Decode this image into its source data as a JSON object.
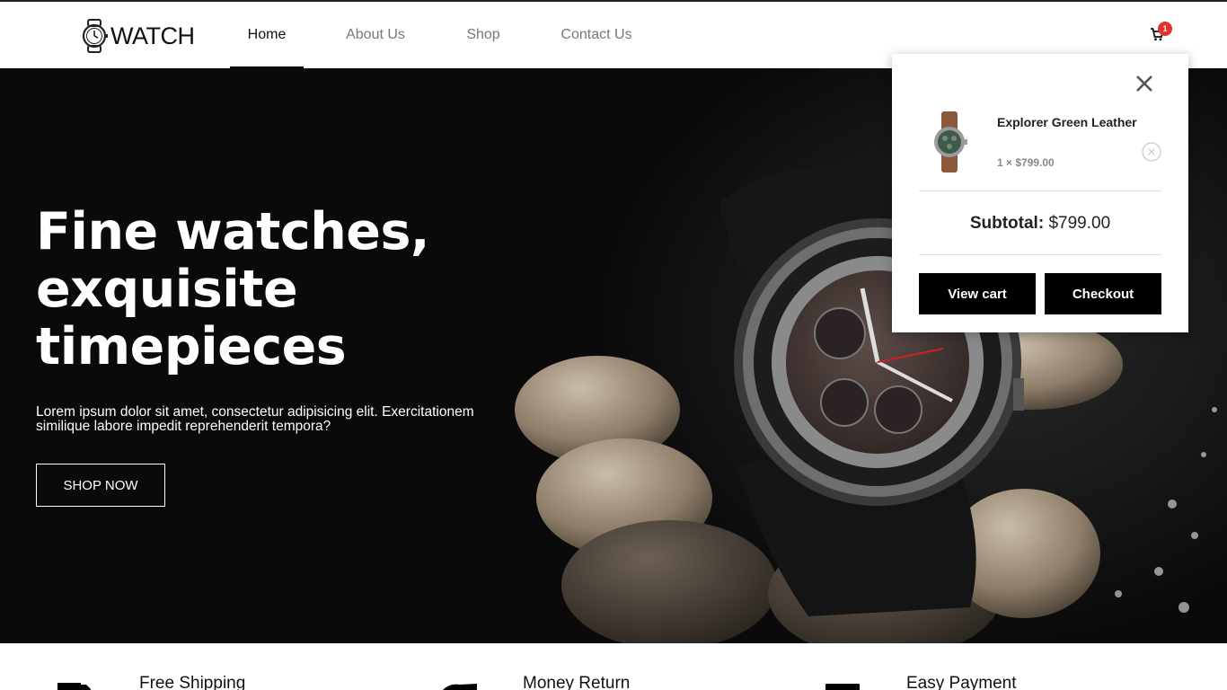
{
  "header": {
    "logo_text": "WATCH",
    "nav": [
      {
        "label": "Home",
        "active": true
      },
      {
        "label": "About Us",
        "active": false
      },
      {
        "label": "Shop",
        "active": false
      },
      {
        "label": "Contact Us",
        "active": false
      }
    ],
    "cart_icon": "shopping-cart-icon",
    "cart_count": "1"
  },
  "hero": {
    "title_lines": [
      "Fine watches,",
      "exquisite",
      "timepieces"
    ],
    "description": "Lorem ipsum dolor sit amet, consectetur adipisicing elit. Exercitationem similique labore impedit reprehenderit tempora?",
    "cta_label": "SHOP NOW"
  },
  "features": [
    {
      "title": "Free Shipping",
      "icon": "truck-icon"
    },
    {
      "title": "Money Return",
      "icon": "money-icon"
    },
    {
      "title": "Easy Payment",
      "icon": "card-icon"
    }
  ],
  "mini_cart": {
    "item_name": "Explorer Green Leather",
    "item_qty_price": "1 × $799.00",
    "subtotal_label": "Subtotal:",
    "subtotal_value": "$799.00",
    "view_cart_label": "View cart",
    "checkout_label": "Checkout"
  },
  "colors": {
    "accent": "#000000",
    "badge": "#e5322d",
    "hero_bg": "#0a0a0a"
  }
}
